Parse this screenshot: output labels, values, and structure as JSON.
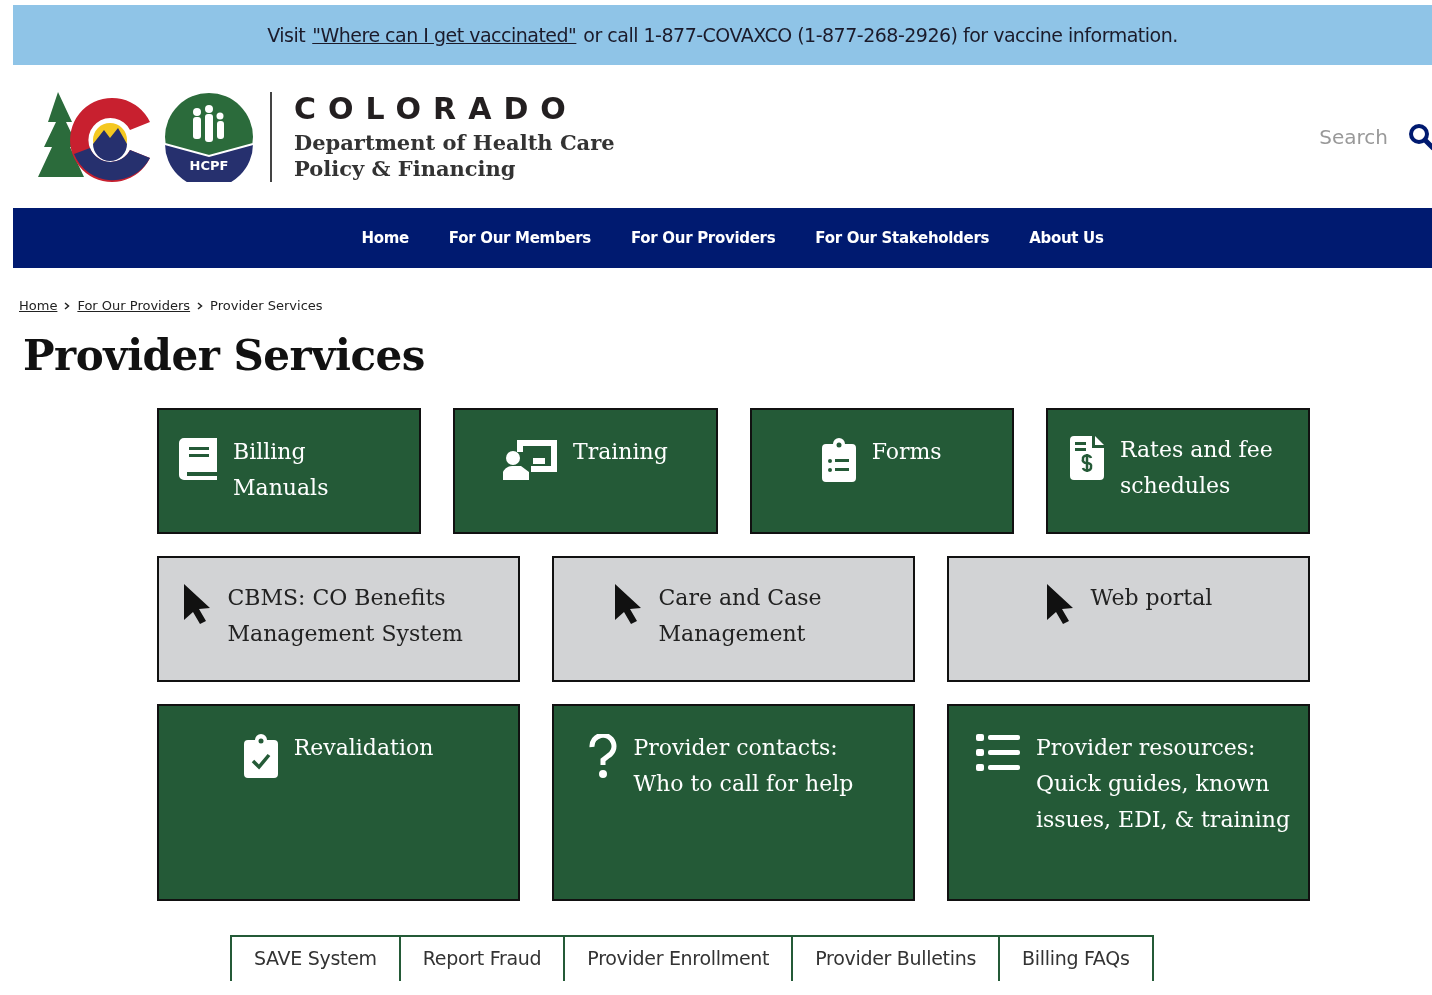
{
  "banner": {
    "prefix": "Visit",
    "link": "\"Where can I get vaccinated\"",
    "suffix": "or call 1-877-COVAXCO (1-877-268-2926) for vaccine information."
  },
  "header": {
    "wordmark": "COLORADO",
    "department": "Department of Health Care Policy & Financing",
    "badge": "HCPF",
    "search": {
      "placeholder": "Search"
    }
  },
  "nav": [
    "Home",
    "For Our Members",
    "For Our Providers",
    "For Our Stakeholders",
    "About Us"
  ],
  "breadcrumb": [
    {
      "label": "Home",
      "link": true
    },
    {
      "label": "For Our Providers",
      "link": true
    },
    {
      "label": "Provider Services",
      "link": false
    }
  ],
  "page_title": "Provider Services",
  "tile_rows": [
    [
      {
        "label": "Billing Manuals",
        "kind": "feature"
      },
      {
        "label": "Training",
        "kind": "feature"
      },
      {
        "label": "Forms",
        "kind": "feature"
      },
      {
        "label": "Rates and fee schedules",
        "kind": "feature"
      }
    ],
    [
      {
        "label": "CBMS: CO Benefits Management System",
        "kind": "external"
      },
      {
        "label": "Care and Case Management",
        "kind": "external"
      },
      {
        "label": "Web portal",
        "kind": "external"
      }
    ],
    [
      {
        "label": "Revalidation",
        "kind": "feature"
      },
      {
        "label": "Provider contacts: Who to call for help",
        "kind": "feature"
      },
      {
        "label": "Provider resources: Quick guides, known issues, EDI, & training",
        "kind": "feature"
      }
    ]
  ],
  "quick_links": [
    "SAVE System",
    "Report Fraud",
    "Provider Enrollment",
    "Provider Bulletins",
    "Billing FAQs"
  ]
}
